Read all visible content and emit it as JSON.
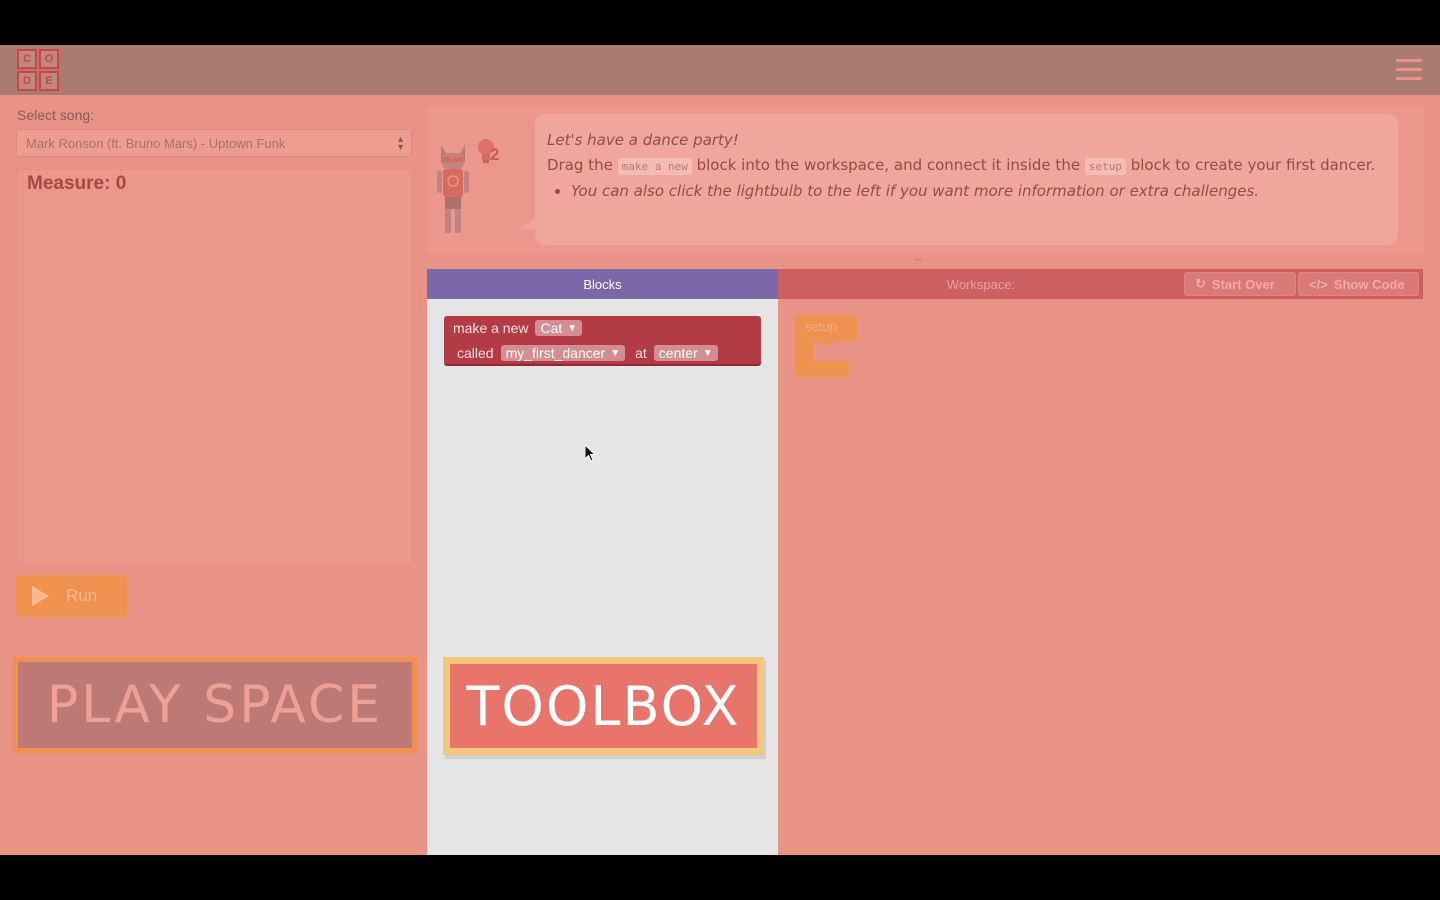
{
  "header": {
    "logo_letters": [
      "C",
      "O",
      "D",
      "E"
    ]
  },
  "left": {
    "song_label": "Select song:",
    "song_value": "Mark Ronson (ft. Bruno Mars) - Uptown Funk",
    "measure": "Measure: 0",
    "run_label": "Run",
    "play_space_callout": "PLAY SPACE"
  },
  "instructions": {
    "intro": "Let's have a dance party!",
    "line_part1": "Drag the ",
    "code1": "make a new",
    "line_part2": " block into the workspace, and connect it inside the ",
    "code2": "setup",
    "line_part3": " block to create your first dancer.",
    "bullet": "You can also click the lightbulb to the left if you want more information or extra challenges.",
    "hint_count": "2"
  },
  "tabs": {
    "blocks": "Blocks",
    "workspace": "Workspace:",
    "start_over": "Start Over",
    "show_code": "Show Code"
  },
  "toolbox": {
    "block_make": "make a new",
    "block_type": "Cat",
    "block_called": "called",
    "block_name": "my_first_dancer",
    "block_at": "at",
    "block_position": "center",
    "callout": "TOOLBOX"
  },
  "workspace": {
    "setup_label": "setup"
  },
  "colors": {
    "header": "#a97b72",
    "overlay": "#e99387",
    "blocks_tab": "#7a68a8",
    "block_red": "#b23b45",
    "setup_orange": "#f0924f",
    "callout_yellow": "#f5c77a"
  }
}
